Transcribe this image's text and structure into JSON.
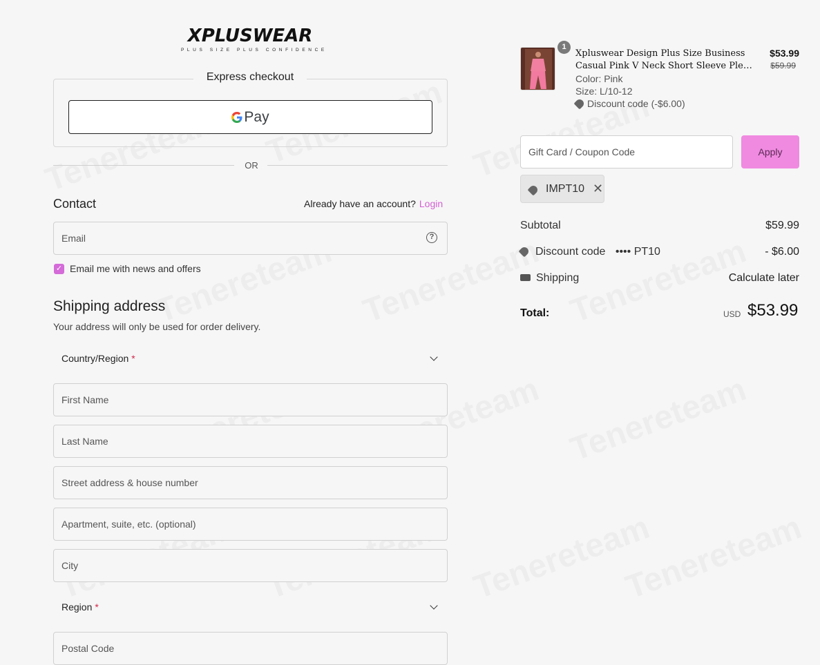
{
  "brand": {
    "name": "XPLUSWEAR",
    "tagline": "PLUS SIZE PLUS CONFIDENCE"
  },
  "express": {
    "title": "Express checkout",
    "gpay_g": "G",
    "gpay_label": "Pay",
    "or": "OR"
  },
  "contact": {
    "heading": "Contact",
    "account_prompt": "Already have an account?",
    "login": "Login",
    "email_placeholder": "Email",
    "help_icon": "?",
    "newsletter_checked": true,
    "newsletter_check_glyph": "✓",
    "newsletter_label": "Email me with news and offers"
  },
  "shipping": {
    "heading": "Shipping address",
    "subtitle": "Your address will only be used for order delivery.",
    "country_label": "Country/Region",
    "required_mark": "*",
    "first_name": "First Name",
    "last_name": "Last Name",
    "street": "Street address & house number",
    "apartment": "Apartment, suite, etc. (optional)",
    "city": "City",
    "region_label": "Region",
    "postal": "Postal Code"
  },
  "cart": {
    "item": {
      "quantity": "1",
      "name_line1": "Xpluswear Design Plus Size Business",
      "name_line2": "Casual Pink V Neck Short Sleeve Pleated...",
      "color": "Color: Pink",
      "size": "Size: L/10-12",
      "discount": "Discount code (-$6.00)",
      "price": "$53.99",
      "original_price": "$59.99"
    },
    "coupon_placeholder": "Gift Card / Coupon Code",
    "apply_label": "Apply",
    "applied_code": "IMPT10",
    "remove_glyph": "✕",
    "subtotal_label": "Subtotal",
    "subtotal_value": "$59.99",
    "discount_label": "Discount code",
    "discount_code_masked": "•••• PT10",
    "discount_value": "- $6.00",
    "shipping_label": "Shipping",
    "shipping_value": "Calculate later",
    "total_label": "Total:",
    "currency": "USD",
    "total_value": "$53.99"
  },
  "watermark": "Tenereteam",
  "colors": {
    "accent": "#d46bd8",
    "apply_bg": "#f08ae0",
    "background": "#f6f6f6"
  }
}
